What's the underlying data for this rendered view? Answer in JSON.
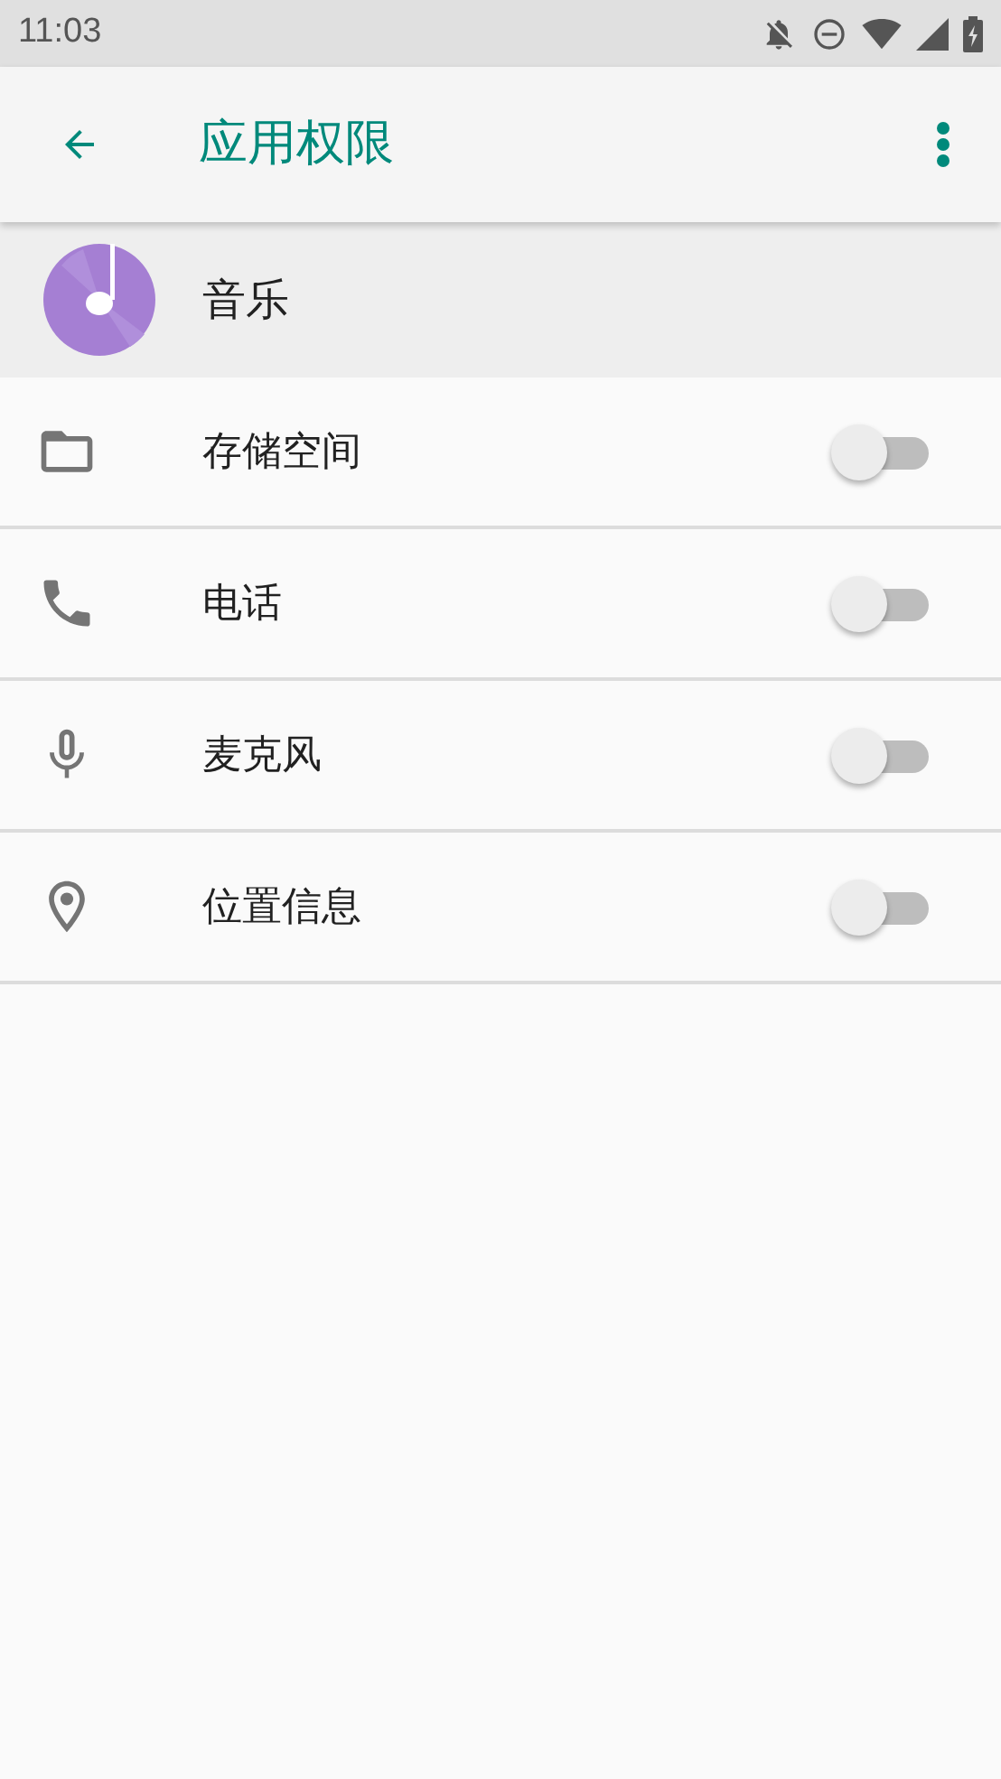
{
  "status_bar": {
    "time": "11:03"
  },
  "app_bar": {
    "title": "应用权限"
  },
  "app": {
    "name": "音乐"
  },
  "permissions": [
    {
      "kind": "storage",
      "label": "存储空间",
      "on": false
    },
    {
      "kind": "phone",
      "label": "电话",
      "on": false
    },
    {
      "kind": "microphone",
      "label": "麦克风",
      "on": false
    },
    {
      "kind": "location",
      "label": "位置信息",
      "on": false
    }
  ]
}
